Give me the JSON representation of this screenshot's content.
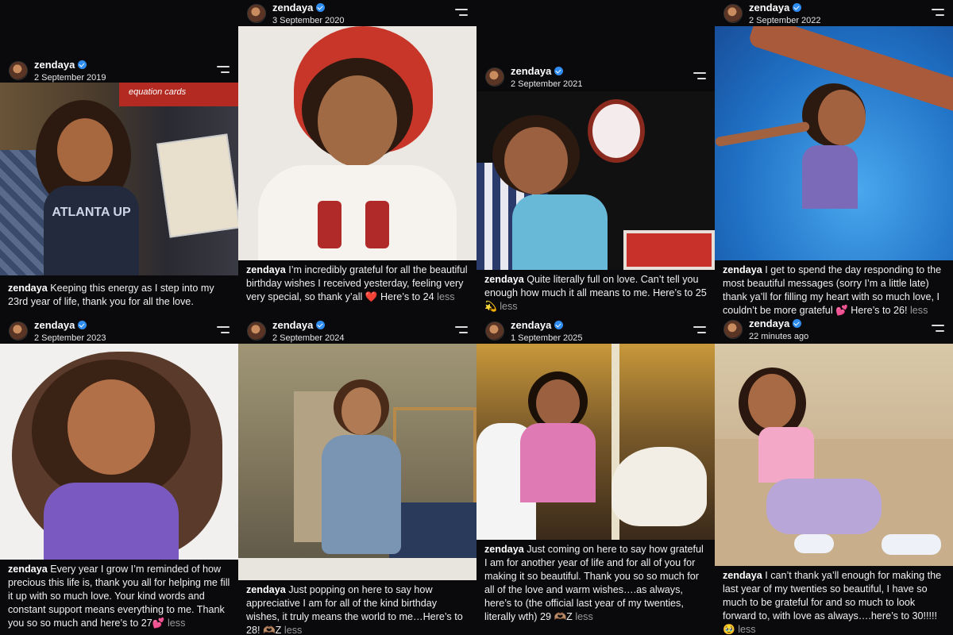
{
  "posts": [
    {
      "username": "zendaya",
      "date": "2 September 2019",
      "caption": "Keeping this energy as I step into my 23rd year of life, thank you for all the love.",
      "photo_colors": [
        "#5a4a3a",
        "#2a2e3a",
        "#e8dcc8"
      ]
    },
    {
      "username": "zendaya",
      "date": "3 September 2020",
      "caption": "I’m incredibly grateful for all the beautiful birthday wishes I received yesterday, feeling very very special, so thank y’all ❤️ Here’s to 24",
      "more": "less",
      "photo_colors": [
        "#e9e5e0",
        "#c23a2e",
        "#f7f4f0"
      ]
    },
    {
      "username": "zendaya",
      "date": "2 September 2021",
      "caption": "Quite literally full on love. Can’t tell you enough how much it all means to me. Here’s to 25 💫",
      "more": "less",
      "photo_colors": [
        "#111111",
        "#7a3a2a",
        "#e8e6ee"
      ]
    },
    {
      "username": "zendaya",
      "date": "2 September 2022",
      "caption": "I get to spend the day responding to the most beautiful messages (sorry I’m a little late) thank ya’ll for filling my heart with so much love, I couldn’t be more grateful 💕 Here’s to 26!",
      "more": "less",
      "photo_colors": [
        "#1d6fc4",
        "#4da3e8",
        "#a25a3a"
      ]
    },
    {
      "username": "zendaya",
      "date": "2 September 2023",
      "caption": "Every year I grow I’m reminded of how precious this life is, thank you all for helping me fill it up with so much love. Your kind words and constant support means everything to me. Thank you so so much and here’s to 27💕",
      "more": "less",
      "photo_colors": [
        "#f2f0ee",
        "#6b4a3a",
        "#8a6ac8"
      ]
    },
    {
      "username": "zendaya",
      "date": "2 September 2024",
      "caption": "Just popping on here to say how appreciative I am for all of the kind birthday wishes, it truly means the world to me…Here’s to 28! 🫶🏽Z",
      "more": "less",
      "photo_colors": [
        "#8a8064",
        "#6a7a8e",
        "#b89060"
      ]
    },
    {
      "username": "zendaya",
      "date": "1 September 2025",
      "caption": "Just coming on here to say how grateful I am for another year of life and for all of you for making it so beautiful. Thank you so so much for all of the love and warm wishes….as always, here’s to (the official last year of my twenties, literally wth) 29 🫶🏽Z",
      "more": "less",
      "photo_colors": [
        "#c89a3a",
        "#e070b0",
        "#3a2a1a"
      ]
    },
    {
      "username": "zendaya",
      "date": "22 minutes ago",
      "caption": "I can’t thank ya’ll enough for making the last year of my twenties so beautiful, I have so much to be grateful for and so much to look forward to, with love as always….here’s to 30!!!!! 🥹",
      "more": "less",
      "photo_colors": [
        "#cdb89a",
        "#f0a8c0",
        "#b8a8d8"
      ]
    }
  ],
  "photos": {
    "p2019_sign_text": "equation cards",
    "p2019_shirt_text": "ATLANTA UP"
  }
}
